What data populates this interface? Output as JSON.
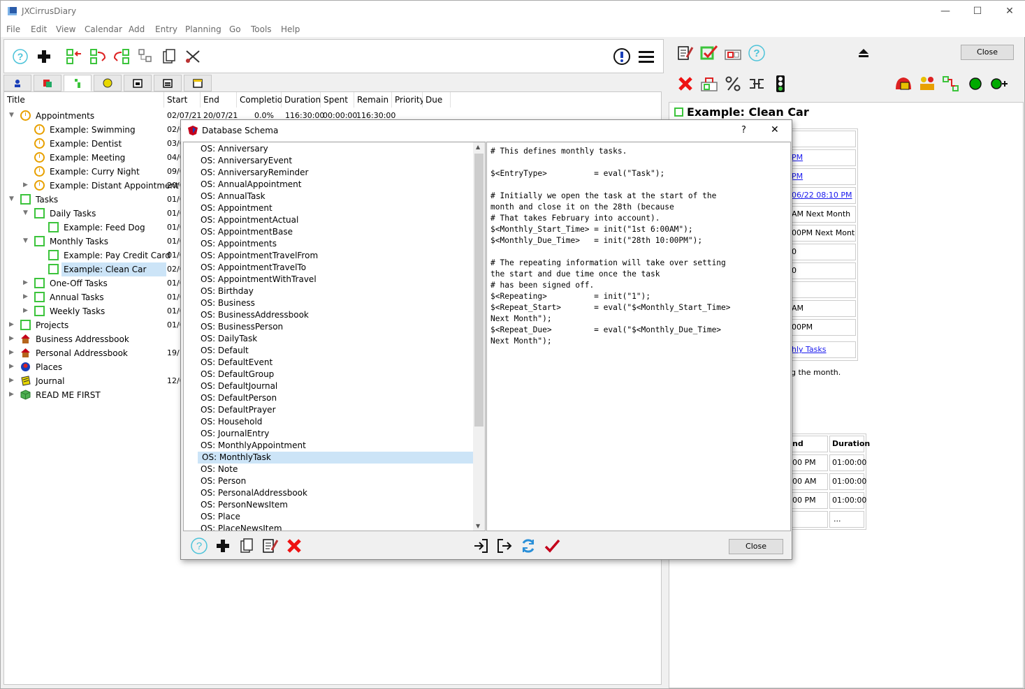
{
  "window": {
    "title": "JXCirrusDiary",
    "minimize": "—",
    "maximize": "☐",
    "close": "✕"
  },
  "menus": [
    "File",
    "Edit",
    "View",
    "Calendar",
    "Add",
    "Entry",
    "Planning",
    "Go",
    "Tools",
    "Help"
  ],
  "columns": [
    "Title",
    "Start",
    "End",
    "Completio",
    "Duration",
    "Spent",
    "Remain",
    "Priority",
    "Due"
  ],
  "tree": [
    {
      "label": "Appointments",
      "start": "02/07/21",
      "end": "20/07/21",
      "completion": "0.0%",
      "duration": "116:30:00",
      "spent": "00:00:00",
      "remain": "116:30:00"
    },
    {
      "label": "Example: Swimming",
      "start": "02/0"
    },
    {
      "label": "Example: Dentist",
      "start": "03/0"
    },
    {
      "label": "Example: Meeting",
      "start": "04/0"
    },
    {
      "label": "Example: Curry Night",
      "start": "09/0"
    },
    {
      "label": "Example: Distant Appointment",
      "start": "20/0"
    },
    {
      "label": "Tasks",
      "start": "01/0"
    },
    {
      "label": "Daily Tasks",
      "start": "01/0"
    },
    {
      "label": "Example: Feed Dog",
      "start": "01/0"
    },
    {
      "label": "Monthly Tasks",
      "start": "01/0"
    },
    {
      "label": "Example: Pay Credit Card",
      "start": "01/0"
    },
    {
      "label": "Example: Clean Car",
      "start": "02/0"
    },
    {
      "label": "One-Off Tasks",
      "start": "01/0"
    },
    {
      "label": "Annual Tasks",
      "start": "01/0"
    },
    {
      "label": "Weekly Tasks",
      "start": "01/0"
    },
    {
      "label": "Projects",
      "start": "01/0"
    },
    {
      "label": "Business Addressbook",
      "start": ""
    },
    {
      "label": "Personal Addressbook",
      "start": "19/1"
    },
    {
      "label": "Places",
      "start": ""
    },
    {
      "label": "Journal",
      "start": "12/0"
    },
    {
      "label": "READ ME FIRST",
      "start": ""
    }
  ],
  "right": {
    "close_button": "Close",
    "title": "Example: Clean Car",
    "fields": [
      "",
      "PM",
      "PM",
      "06/22 08:10 PM",
      "AM Next Month",
      "00PM Next Month",
      "0",
      "0",
      "",
      "AM",
      "00PM",
      "hly Tasks"
    ],
    "note": "g the month.",
    "table_header": [
      "nd",
      "Duration"
    ],
    "table_rows": [
      [
        "00 PM",
        "01:00:00"
      ],
      [
        "00 AM",
        "01:00:00"
      ],
      [
        "00 PM",
        "01:00:00"
      ],
      [
        "",
        "..."
      ]
    ]
  },
  "dialog": {
    "title": "Database Schema",
    "help": "?",
    "close": "✕",
    "close_button": "Close",
    "items": [
      "OS: Anniversary",
      "OS: AnniversaryEvent",
      "OS: AnniversaryReminder",
      "OS: AnnualAppointment",
      "OS: AnnualTask",
      "OS: Appointment",
      "OS: AppointmentActual",
      "OS: AppointmentBase",
      "OS: Appointments",
      "OS: AppointmentTravelFrom",
      "OS: AppointmentTravelTo",
      "OS: AppointmentWithTravel",
      "OS: Birthday",
      "OS: Business",
      "OS: BusinessAddressbook",
      "OS: BusinessPerson",
      "OS: DailyTask",
      "OS: Default",
      "OS: DefaultEvent",
      "OS: DefaultGroup",
      "OS: DefaultJournal",
      "OS: DefaultPerson",
      "OS: DefaultPrayer",
      "OS: Household",
      "OS: JournalEntry",
      "OS: MonthlyAppointment",
      "OS: MonthlyTask",
      "OS: Note",
      "OS: Person",
      "OS: PersonalAddressbook",
      "OS: PersonNewsItem",
      "OS: Place",
      "OS: PlaceNewsItem"
    ],
    "code": [
      "# This defines monthly tasks.",
      "",
      "$<EntryType>          = eval(\"Task\");",
      "",
      "# Initially we open the task at the start of the",
      "month and close it on the 28th (because",
      "# That takes February into account).",
      "$<Monthly_Start_Time> = init(\"1st 6:00AM\");",
      "$<Monthly_Due_Time>   = init(\"28th 10:00PM\");",
      "",
      "# The repeating information will take over setting",
      "the start and due time once the task",
      "# has been signed off.",
      "$<Repeating>          = init(\"1\");",
      "$<Repeat_Start>       = eval(\"$<Monthly_Start_Time>",
      "Next Month\");",
      "$<Repeat_Due>         = eval(\"$<Monthly_Due_Time>",
      "Next Month\");"
    ]
  }
}
